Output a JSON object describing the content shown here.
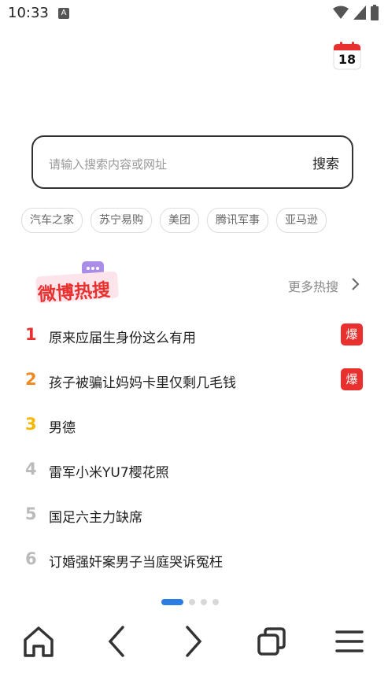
{
  "status_bar": {
    "time": "10:33",
    "notification_icon": "A"
  },
  "calendar": {
    "day": "18",
    "icon": "calendar-icon"
  },
  "search": {
    "placeholder": "请输入搜索内容或网址",
    "button_label": "搜索"
  },
  "quick_links": [
    "汽车之家",
    "苏宁易购",
    "美团",
    "腾讯军事",
    "亚马逊"
  ],
  "hot_search": {
    "logo_text": "微博热搜",
    "more_label": "更多热搜",
    "items": [
      {
        "rank": "1",
        "title": "原来应届生身份这么有用",
        "badge": "爆",
        "rank_color": "#e8302f"
      },
      {
        "rank": "2",
        "title": "孩子被骗让妈妈卡里仅剩几毛钱",
        "badge": "爆",
        "rank_color": "#f08a24"
      },
      {
        "rank": "3",
        "title": "男德",
        "badge": "",
        "rank_color": "#f5b800"
      },
      {
        "rank": "4",
        "title": "雷军小米YU7樱花照",
        "badge": "",
        "rank_color": "#bbbbbb"
      },
      {
        "rank": "5",
        "title": "国足六主力缺席",
        "badge": "",
        "rank_color": "#bbbbbb"
      },
      {
        "rank": "6",
        "title": "订婚强奸案男子当庭哭诉冤枉",
        "badge": "",
        "rank_color": "#bbbbbb"
      }
    ]
  },
  "pager": {
    "pages": 4,
    "active_index": 0
  },
  "bottom_nav": [
    "home-icon",
    "back-icon",
    "forward-icon",
    "tabs-icon",
    "menu-icon"
  ],
  "colors": {
    "accent": "#2b7de1",
    "hot_badge": "#e8302f",
    "search_border": "#333333"
  }
}
